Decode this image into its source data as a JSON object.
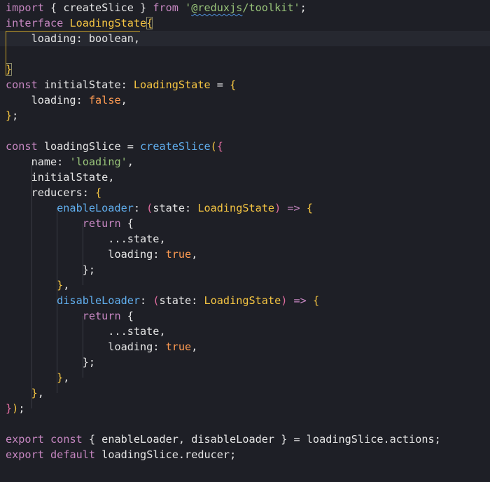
{
  "colors": {
    "background": "#1e1f26",
    "current_line": "#262830",
    "keyword": "#c586c0",
    "plain": "#e6e6e6",
    "type": "#f5c542",
    "string": "#98c379",
    "boolean": "#ff9b52",
    "function": "#61afef",
    "bracket_yellow": "#f5c542",
    "bracket_pink": "#e06c9f",
    "operator": "#c586c0",
    "guide": "#3a3c44"
  },
  "editor": {
    "lines": [
      [
        {
          "t": "import",
          "c": "keyword"
        },
        {
          "t": " { ",
          "c": "plain"
        },
        {
          "t": "createSlice",
          "c": "plain"
        },
        {
          "t": " } ",
          "c": "plain"
        },
        {
          "t": "from",
          "c": "keyword"
        },
        {
          "t": " '",
          "c": "string"
        },
        {
          "t": "@reduxjs",
          "c": "string",
          "squiggle": true
        },
        {
          "t": "/toolkit'",
          "c": "string"
        },
        {
          "t": ";",
          "c": "plain"
        }
      ],
      [
        {
          "t": "interface",
          "c": "keyword"
        },
        {
          "t": " ",
          "c": "plain"
        },
        {
          "t": "LoadingState",
          "c": "type"
        },
        {
          "t": "{",
          "c": "bracket_yellow",
          "box": true
        }
      ],
      [
        {
          "t": "    loading",
          "c": "plain"
        },
        {
          "t": ": ",
          "c": "plain"
        },
        {
          "t": "boolean",
          "c": "plain"
        },
        {
          "t": ",",
          "c": "plain"
        }
      ],
      [],
      [
        {
          "t": "}",
          "c": "bracket_yellow",
          "box": true
        }
      ],
      [
        {
          "t": "const",
          "c": "keyword"
        },
        {
          "t": " initialState",
          "c": "plain"
        },
        {
          "t": ": ",
          "c": "plain"
        },
        {
          "t": "LoadingState",
          "c": "type"
        },
        {
          "t": " = ",
          "c": "plain"
        },
        {
          "t": "{",
          "c": "bracket_yellow"
        }
      ],
      [
        {
          "t": "    loading",
          "c": "plain"
        },
        {
          "t": ": ",
          "c": "plain"
        },
        {
          "t": "false",
          "c": "boolean"
        },
        {
          "t": ",",
          "c": "plain"
        }
      ],
      [
        {
          "t": "}",
          "c": "bracket_yellow"
        },
        {
          "t": ";",
          "c": "plain"
        }
      ],
      [],
      [
        {
          "t": "const",
          "c": "keyword"
        },
        {
          "t": " loadingSlice ",
          "c": "plain"
        },
        {
          "t": "= ",
          "c": "plain"
        },
        {
          "t": "createSlice",
          "c": "function"
        },
        {
          "t": "(",
          "c": "bracket_yellow"
        },
        {
          "t": "{",
          "c": "bracket_pink_alt"
        }
      ],
      [
        {
          "t": "    name",
          "c": "plain"
        },
        {
          "t": ": ",
          "c": "plain"
        },
        {
          "t": "'loading'",
          "c": "string"
        },
        {
          "t": ",",
          "c": "plain"
        }
      ],
      [
        {
          "t": "    initialState",
          "c": "plain"
        },
        {
          "t": ",",
          "c": "plain"
        }
      ],
      [
        {
          "t": "    reducers",
          "c": "plain"
        },
        {
          "t": ": ",
          "c": "plain"
        },
        {
          "t": "{",
          "c": "bracket_yellow"
        }
      ],
      [
        {
          "t": "        enableLoader",
          "c": "function"
        },
        {
          "t": ": ",
          "c": "plain"
        },
        {
          "t": "(",
          "c": "bracket_pink"
        },
        {
          "t": "state",
          "c": "plain"
        },
        {
          "t": ": ",
          "c": "plain"
        },
        {
          "t": "LoadingState",
          "c": "type"
        },
        {
          "t": ")",
          "c": "bracket_pink"
        },
        {
          "t": " => ",
          "c": "operator"
        },
        {
          "t": "{",
          "c": "bracket_yellow"
        }
      ],
      [
        {
          "t": "            return",
          "c": "keyword"
        },
        {
          "t": " {",
          "c": "plain"
        }
      ],
      [
        {
          "t": "                ...state",
          "c": "plain"
        },
        {
          "t": ",",
          "c": "plain"
        }
      ],
      [
        {
          "t": "                loading",
          "c": "plain"
        },
        {
          "t": ": ",
          "c": "plain"
        },
        {
          "t": "true",
          "c": "boolean"
        },
        {
          "t": ",",
          "c": "plain"
        }
      ],
      [
        {
          "t": "            }",
          "c": "plain"
        },
        {
          "t": ";",
          "c": "plain"
        }
      ],
      [
        {
          "t": "        }",
          "c": "bracket_yellow"
        },
        {
          "t": ",",
          "c": "plain"
        }
      ],
      [
        {
          "t": "        disableLoader",
          "c": "function"
        },
        {
          "t": ": ",
          "c": "plain"
        },
        {
          "t": "(",
          "c": "bracket_pink"
        },
        {
          "t": "state",
          "c": "plain"
        },
        {
          "t": ": ",
          "c": "plain"
        },
        {
          "t": "LoadingState",
          "c": "type"
        },
        {
          "t": ")",
          "c": "bracket_pink"
        },
        {
          "t": " => ",
          "c": "operator"
        },
        {
          "t": "{",
          "c": "bracket_yellow"
        }
      ],
      [
        {
          "t": "            return",
          "c": "keyword"
        },
        {
          "t": " {",
          "c": "plain"
        }
      ],
      [
        {
          "t": "                ...state",
          "c": "plain"
        },
        {
          "t": ",",
          "c": "plain"
        }
      ],
      [
        {
          "t": "                loading",
          "c": "plain"
        },
        {
          "t": ": ",
          "c": "plain"
        },
        {
          "t": "true",
          "c": "boolean"
        },
        {
          "t": ",",
          "c": "plain"
        }
      ],
      [
        {
          "t": "            }",
          "c": "plain"
        },
        {
          "t": ";",
          "c": "plain"
        }
      ],
      [
        {
          "t": "        }",
          "c": "bracket_yellow"
        },
        {
          "t": ",",
          "c": "plain"
        }
      ],
      [
        {
          "t": "    }",
          "c": "bracket_yellow"
        },
        {
          "t": ",",
          "c": "plain"
        }
      ],
      [
        {
          "t": "}",
          "c": "bracket_pink_alt"
        },
        {
          "t": ")",
          "c": "bracket_yellow"
        },
        {
          "t": ";",
          "c": "plain"
        }
      ],
      [],
      [
        {
          "t": "export",
          "c": "keyword"
        },
        {
          "t": " ",
          "c": "plain"
        },
        {
          "t": "const",
          "c": "keyword"
        },
        {
          "t": " { enableLoader, disableLoader } = loadingSlice.actions;",
          "c": "plain"
        }
      ],
      [
        {
          "t": "export",
          "c": "keyword"
        },
        {
          "t": " ",
          "c": "plain"
        },
        {
          "t": "default",
          "c": "keyword"
        },
        {
          "t": " loadingSlice.reducer;",
          "c": "plain"
        }
      ]
    ]
  }
}
